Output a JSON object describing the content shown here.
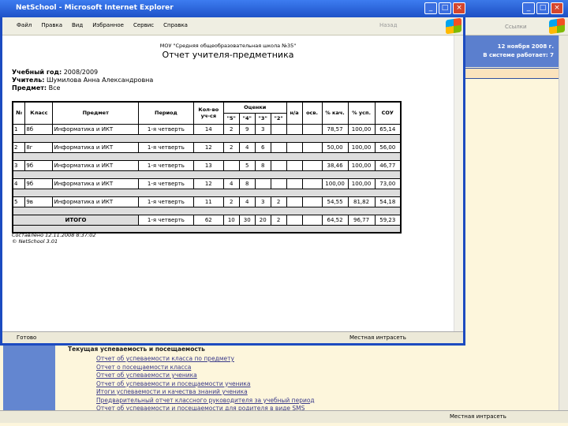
{
  "background_window": {
    "links_label": "Ссылки",
    "date": "12 ноября 2008 г.",
    "online": "В системе работает: 7",
    "section_title": "Текущая успеваемость и посещаемость",
    "links": [
      "Отчет об успеваемости класса по предмету",
      "Отчет о посещаемости класса",
      "Отчет об успеваемости ученика",
      "Отчет об успеваемости и посещаемости ученика",
      "Итоги успеваемости и качества знаний ученика",
      "Предварительный отчет классного руководителя за учебный период",
      "Отчет об успеваемости и посещаемости для родителя в виде SMS"
    ],
    "status_zone": "Местная интрасеть"
  },
  "window": {
    "title": "NetSchool - Microsoft Internet Explorer",
    "menu": [
      "Файл",
      "Правка",
      "Вид",
      "Избранное",
      "Сервис",
      "Справка"
    ],
    "back": "Назад",
    "status": "Готово",
    "status_zone": "Местная интрасеть"
  },
  "report": {
    "school": "МОУ \"Средняя общеобразовательная школа №35\"",
    "title": "Отчет учителя-предметника",
    "year_label": "Учебный год:",
    "year": "2008/2009",
    "teacher_label": "Учитель:",
    "teacher": "Шумилова Анна Александровна",
    "subject_label": "Предмет:",
    "subject": "Все",
    "headers": {
      "num": "№",
      "class": "Класс",
      "subject": "Предмет",
      "period": "Период",
      "count": "Кол-во уч-ся",
      "grades": "Оценки",
      "g5": "\"5\"",
      "g4": "\"4\"",
      "g3": "\"3\"",
      "g2": "\"2\"",
      "na": "н/а",
      "osv": "осв.",
      "quality": "% кач.",
      "success": "% усп.",
      "sou": "СОУ"
    },
    "rows": [
      [
        "1",
        "8б",
        "Информатика и ИКТ",
        "1-я четверть",
        "14",
        "2",
        "9",
        "3",
        "",
        "",
        "",
        "78,57",
        "100,00",
        "65,14"
      ],
      [
        "2",
        "8г",
        "Информатика и ИКТ",
        "1-я четверть",
        "12",
        "2",
        "4",
        "6",
        "",
        "",
        "",
        "50,00",
        "100,00",
        "56,00"
      ],
      [
        "3",
        "9б",
        "Информатика и ИКТ",
        "1-я четверть",
        "13",
        "",
        "5",
        "8",
        "",
        "",
        "",
        "38,46",
        "100,00",
        "46,77"
      ],
      [
        "4",
        "9б",
        "Информатика и ИКТ",
        "1-я четверть",
        "12",
        "4",
        "8",
        "",
        "",
        "",
        "",
        "100,00",
        "100,00",
        "73,00"
      ],
      [
        "5",
        "9в",
        "Информатика и ИКТ",
        "1-я четверть",
        "11",
        "2",
        "4",
        "3",
        "2",
        "",
        "",
        "54,55",
        "81,82",
        "54,18"
      ]
    ],
    "total": [
      "ИТОГО",
      "1-я четверть",
      "62",
      "10",
      "30",
      "20",
      "2",
      "",
      "",
      "64,52",
      "96,77",
      "59,23"
    ],
    "created": "Составлено 12.11.2008 8:37:02",
    "copyright": "© NetSchool 3.01"
  }
}
